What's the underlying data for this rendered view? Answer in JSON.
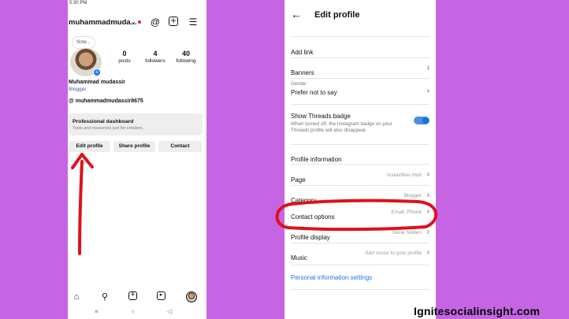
{
  "left_phone": {
    "status_time": "5:30 PM",
    "username": "muhammadmuda...",
    "note_label": "Note...",
    "stats": [
      {
        "value": "0",
        "label": "posts"
      },
      {
        "value": "4",
        "label": "followers"
      },
      {
        "value": "40",
        "label": "following"
      }
    ],
    "display_name": "Muhammad mudassir",
    "category": "Blogger",
    "threads_handle": "muhammadmudassir8675",
    "dashboard_title": "Professional dashboard",
    "dashboard_subtitle": "Tools and resources just for creators.",
    "buttons": {
      "edit": "Edit profile",
      "share": "Share profile",
      "contact": "Contact"
    }
  },
  "right_phone": {
    "title": "Edit profile",
    "add_link": "Add link",
    "banners": {
      "label": "Banners",
      "value": "1"
    },
    "gender": {
      "caption": "Gender",
      "value": "Prefer not to say"
    },
    "threads_badge": {
      "label": "Show Threads badge",
      "description": "When turned off, the Instagram badge on your Threads profile will also disappear.",
      "enabled": true
    },
    "section_title": "Profile information",
    "page": {
      "label": "Page",
      "value": "InstaVibes Hub"
    },
    "category": {
      "label": "Category",
      "value": "Blogger"
    },
    "contact_options": {
      "label": "Contact options",
      "value": "Email, Phone"
    },
    "profile_display": {
      "label": "Profile display",
      "value": "None hidden"
    },
    "music": {
      "label": "Music",
      "value": "Add music to your profile"
    },
    "personal_settings": "Personal information settings"
  },
  "brand": "Ignitesocialinsight.com",
  "colors": {
    "background": "#c565e3",
    "annotation": "#e0101a",
    "link": "#1877f2"
  }
}
